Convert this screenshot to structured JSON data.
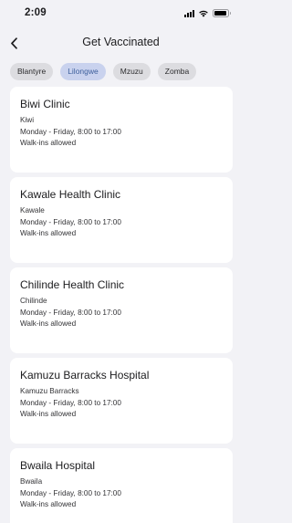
{
  "status_bar": {
    "time": "2:09"
  },
  "header": {
    "title": "Get Vaccinated"
  },
  "filters": [
    {
      "label": "Blantyre",
      "selected": false
    },
    {
      "label": "Lilongwe",
      "selected": true
    },
    {
      "label": "Mzuzu",
      "selected": false
    },
    {
      "label": "Zomba",
      "selected": false
    }
  ],
  "clinics": [
    {
      "name": "Biwi Clinic",
      "area": "Kiwi",
      "hours": "Monday - Friday, 8:00 to 17:00",
      "walkin": "Walk-ins allowed"
    },
    {
      "name": "Kawale Health Clinic",
      "area": "Kawale",
      "hours": "Monday - Friday, 8:00 to 17:00",
      "walkin": "Walk-ins allowed"
    },
    {
      "name": "Chilinde Health Clinic",
      "area": "Chilinde",
      "hours": "Monday - Friday, 8:00 to 17:00",
      "walkin": "Walk-ins allowed"
    },
    {
      "name": "Kamuzu Barracks Hospital",
      "area": "Kamuzu Barracks",
      "hours": "Monday - Friday, 8:00 to 17:00",
      "walkin": "Walk-ins allowed"
    },
    {
      "name": "Bwaila Hospital",
      "area": "Bwaila",
      "hours": "Monday - Friday, 8:00 to 17:00",
      "walkin": "Walk-ins allowed"
    }
  ],
  "colors": {
    "accent": "#3d5f9c",
    "selected_chip_bg": "#c9d2ee",
    "background": "#f2f2f6"
  }
}
